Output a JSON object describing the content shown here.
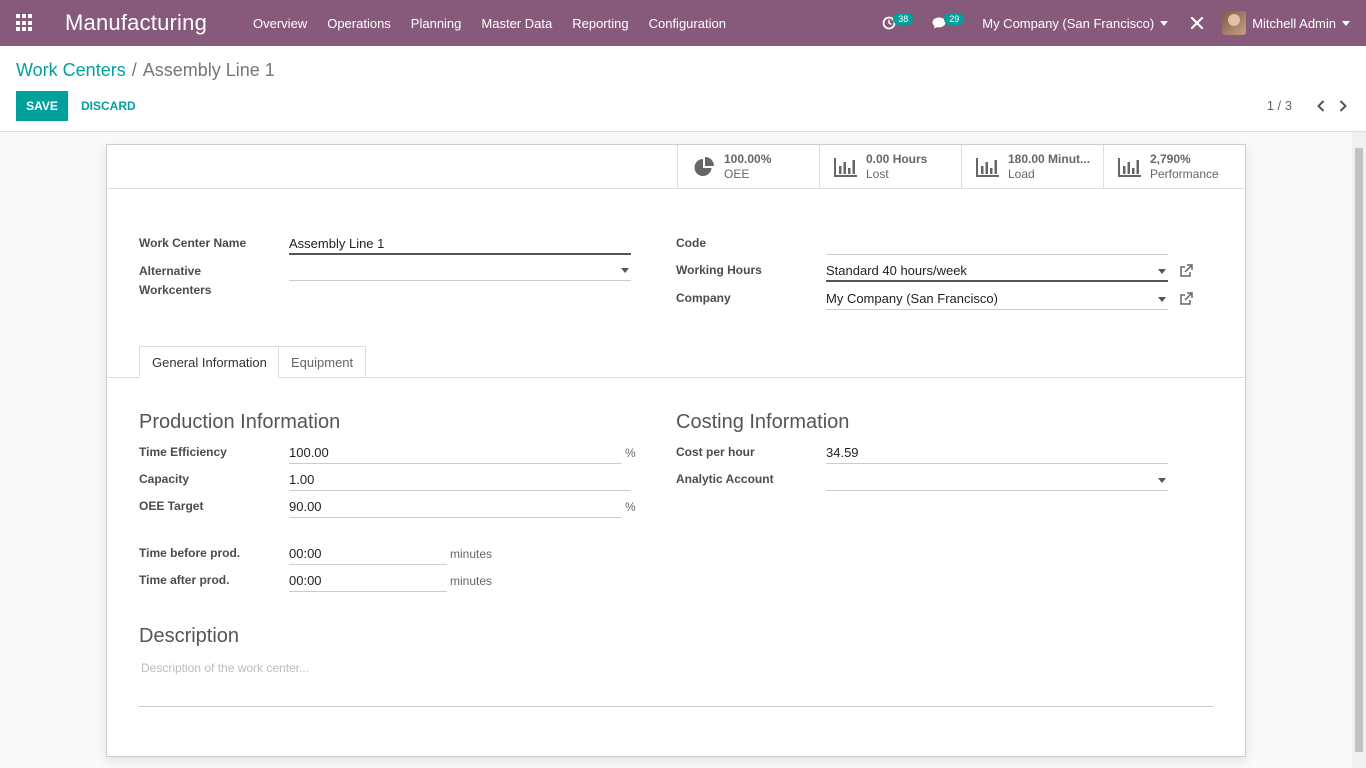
{
  "navbar": {
    "brand": "Manufacturing",
    "menu": [
      "Overview",
      "Operations",
      "Planning",
      "Master Data",
      "Reporting",
      "Configuration"
    ],
    "activity_count": "38",
    "message_count": "29",
    "company": "My Company (San Francisco)",
    "user": "Mitchell Admin"
  },
  "breadcrumb": {
    "parent": "Work Centers",
    "separator": "/",
    "current": "Assembly Line 1"
  },
  "actions": {
    "save": "SAVE",
    "discard": "DISCARD"
  },
  "pager": {
    "value": "1 / 3"
  },
  "stats": [
    {
      "value": "100.00%",
      "label": "OEE",
      "icon": "pie-chart-icon"
    },
    {
      "value": "0.00 Hours",
      "label": "Lost",
      "icon": "bar-chart-icon"
    },
    {
      "value": "180.00 Minut...",
      "label": "Load",
      "icon": "bar-chart-icon"
    },
    {
      "value": "2,790%",
      "label": "Performance",
      "icon": "bar-chart-icon"
    }
  ],
  "form": {
    "name_label": "Work Center Name",
    "name_value": "Assembly Line 1",
    "alt_label_1": "Alternative",
    "alt_label_2": "Workcenters",
    "alt_value": "",
    "code_label": "Code",
    "code_value": "",
    "hours_label": "Working Hours",
    "hours_value": "Standard 40 hours/week",
    "company_label": "Company",
    "company_value": "My Company (San Francisco)"
  },
  "tabs": {
    "general": "General Information",
    "equipment": "Equipment"
  },
  "production": {
    "title": "Production Information",
    "efficiency_label": "Time Efficiency",
    "efficiency_value": "100.00",
    "capacity_label": "Capacity",
    "capacity_value": "1.00",
    "oee_label": "OEE Target",
    "oee_value": "90.00",
    "percent": "%",
    "before_label": "Time before prod.",
    "before_value": "00:00",
    "after_label": "Time after prod.",
    "after_value": "00:00",
    "minutes": "minutes"
  },
  "costing": {
    "title": "Costing Information",
    "cost_label": "Cost per hour",
    "cost_value": "34.59",
    "analytic_label": "Analytic Account",
    "analytic_value": ""
  },
  "description": {
    "title": "Description",
    "placeholder": "Description of the work center..."
  },
  "colors": {
    "navbar": "#875a7b",
    "accent": "#00a09d"
  }
}
